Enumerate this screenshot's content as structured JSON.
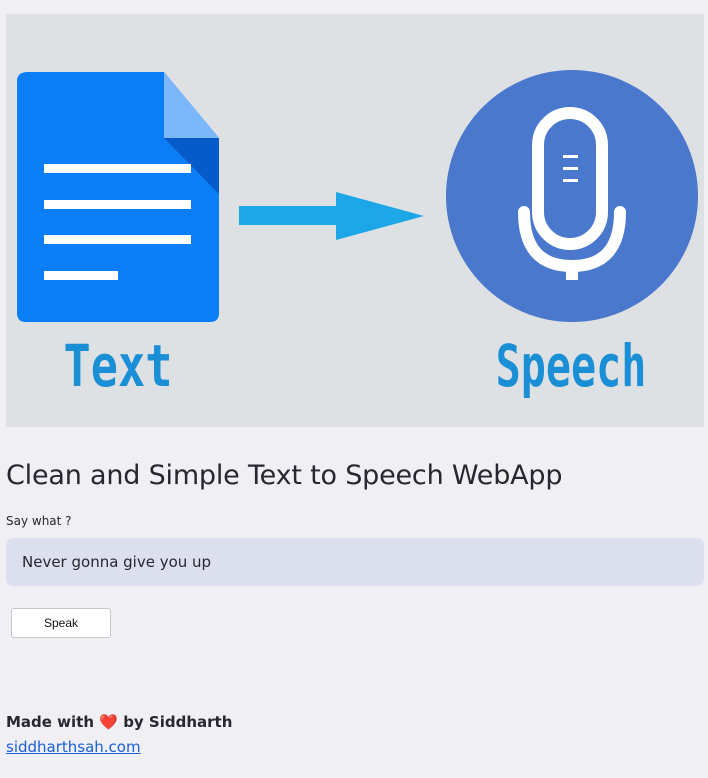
{
  "hero": {
    "left_caption": "Text",
    "right_caption": "Speech",
    "colors": {
      "background": "#dde1e4",
      "document": "#0b7df5",
      "arrow": "#1ea7e8",
      "mic_circle": "#4a78cc",
      "caption": "#1a8fd6"
    }
  },
  "page": {
    "title": "Clean and Simple Text to Speech WebApp"
  },
  "input": {
    "label": "Say what ?",
    "value": "Never gonna give you up"
  },
  "speak_button": {
    "label": "Speak"
  },
  "footer": {
    "made_with": "Made with",
    "heart": "❤️",
    "by": "by Siddharth",
    "link_text": "siddharthsah.com"
  }
}
